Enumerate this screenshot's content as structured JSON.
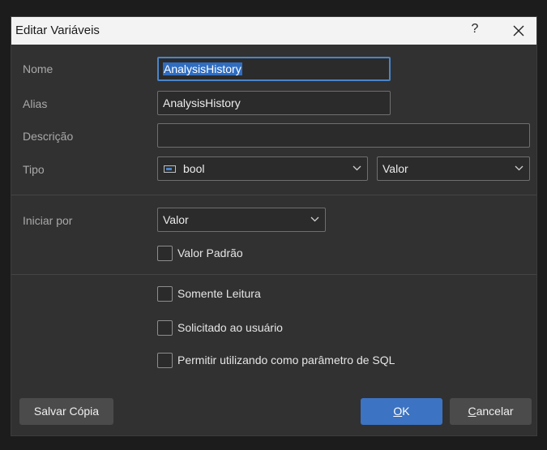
{
  "window": {
    "title": "Editar Variáveis",
    "help_label": "?"
  },
  "form": {
    "name_label": "Nome",
    "name_value": "AnalysisHistory",
    "alias_label": "Alias",
    "alias_value": "AnalysisHistory",
    "description_label": "Descrição",
    "description_value": "",
    "type_label": "Tipo",
    "type_value": "bool",
    "type_icon": "boolean-type-icon",
    "value_kind": "Valor",
    "init_label": "Iniciar por",
    "init_value": "Valor",
    "default_value_label": "Valor Padrão",
    "default_value_checked": false
  },
  "options": [
    {
      "label": "Somente Leitura",
      "checked": false
    },
    {
      "label": "Solicitado ao usuário",
      "checked": false
    },
    {
      "label": "Permitir utilizando como parâmetro de SQL",
      "checked": false
    }
  ],
  "buttons": {
    "save_copy": "Salvar Cópia",
    "ok_mnemonic": "O",
    "ok_rest": "K",
    "cancel_mnemonic": "C",
    "cancel_rest": "ancelar"
  },
  "colors": {
    "accent": "#3c73c3",
    "focus_border": "#4a84c9",
    "dialog_bg": "#313131",
    "titlebar_bg": "#f3f3f3"
  }
}
